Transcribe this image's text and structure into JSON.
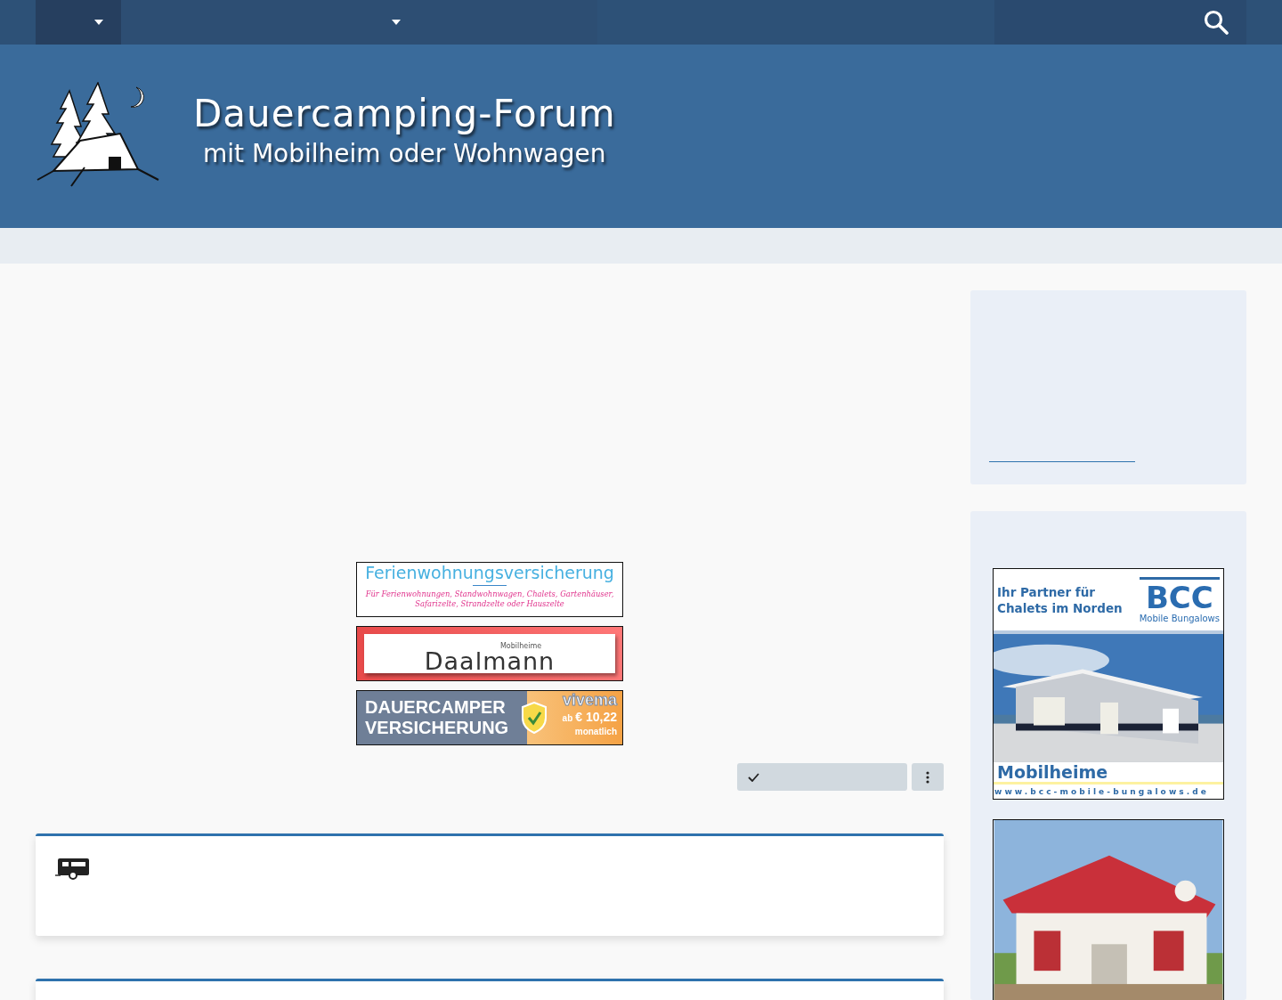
{
  "nav": {
    "items": [
      {
        "selected": true
      },
      {
        "selected": false
      }
    ]
  },
  "header": {
    "title": "Dauercamping-Forum",
    "subtitle": "mit Mobilheim oder Wohnwagen"
  },
  "banners": [
    {
      "kind": "insurance",
      "title": "Ferienwohnungsversicherung",
      "text": "Für Ferienwohnungen, Standwohnwagen, Chalets, Gartenhäuser, Safarizelte, Strandzelte oder Hauszelte"
    },
    {
      "kind": "dealer",
      "small": "Mobilheime",
      "name": "Daalmann"
    },
    {
      "kind": "camper",
      "lines": [
        "DAUERCAMPER",
        "VERSICHERUNG"
      ],
      "brand": "vivema",
      "prefix": "ab",
      "price": "€ 10,22",
      "period": "monatlich"
    }
  ],
  "sidebar_ads": [
    {
      "kind": "bcc",
      "lines": [
        "Ihr Partner für",
        "Chalets im Norden"
      ],
      "logo": "BCC",
      "logo_sub": "Mobile Bungalows",
      "caption": "Mobilheime",
      "url": "www.bcc-mobile-bungalows.de"
    },
    {
      "kind": "picture"
    }
  ]
}
